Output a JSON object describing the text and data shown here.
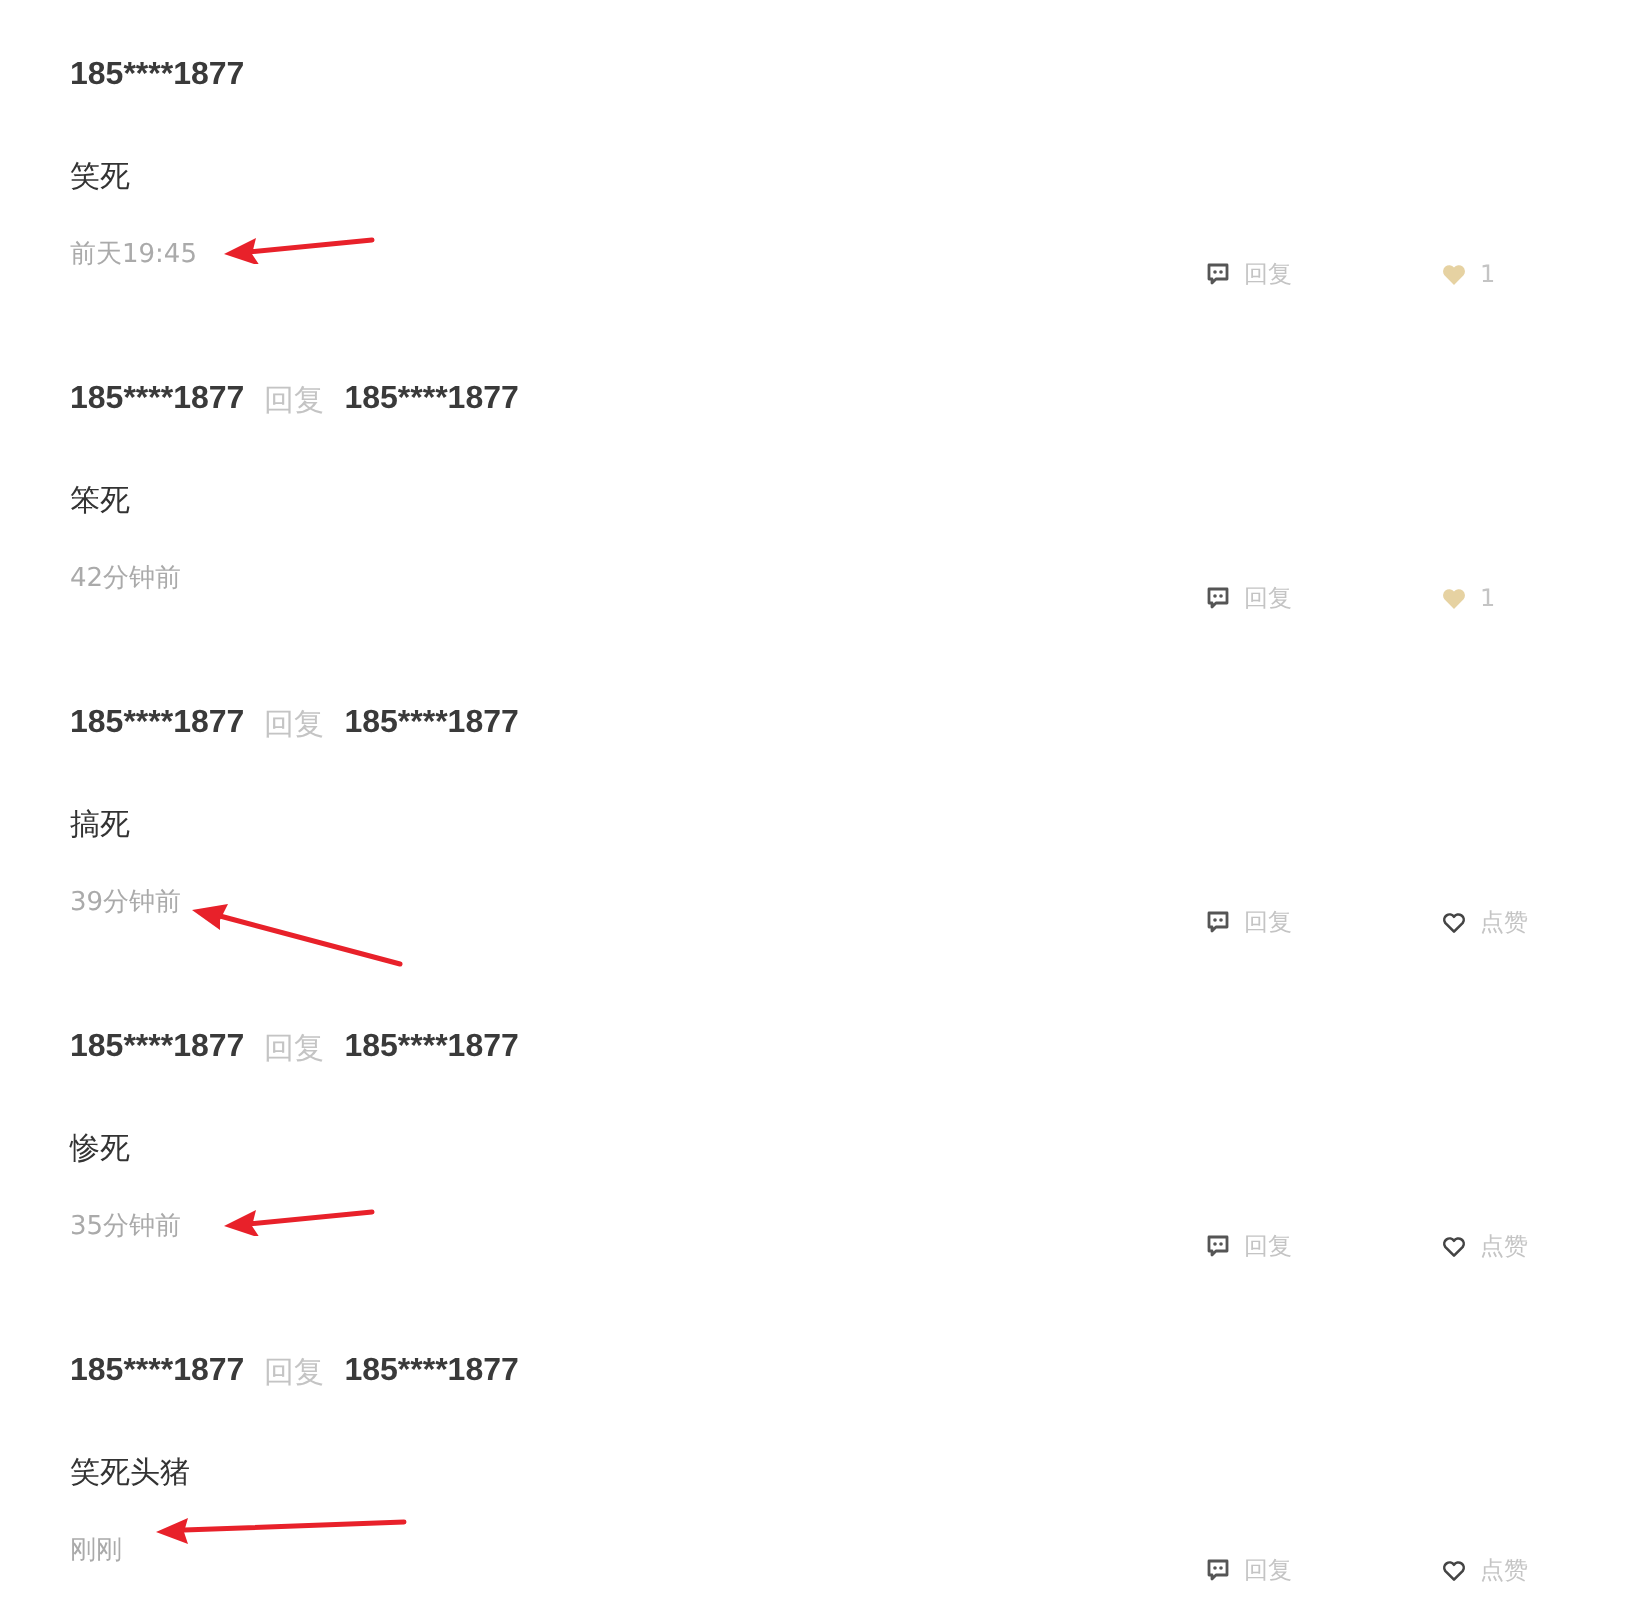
{
  "comments": [
    {
      "author": "185****1877",
      "content": "笑死",
      "time": "前天19:45",
      "reply_action": "回复",
      "liked": true,
      "like_text": "1",
      "annotated": true
    },
    {
      "author": "185****1877",
      "reply_word": "回复",
      "reply_to": "185****1877",
      "content": "笨死",
      "time": "42分钟前",
      "reply_action": "回复",
      "liked": true,
      "like_text": "1",
      "annotated": false
    },
    {
      "author": "185****1877",
      "reply_word": "回复",
      "reply_to": "185****1877",
      "content": "搞死",
      "time": "39分钟前",
      "reply_action": "回复",
      "liked": false,
      "like_text": "点赞",
      "annotated": true
    },
    {
      "author": "185****1877",
      "reply_word": "回复",
      "reply_to": "185****1877",
      "content": "惨死",
      "time": "35分钟前",
      "reply_action": "回复",
      "liked": false,
      "like_text": "点赞",
      "annotated": true
    },
    {
      "author": "185****1877",
      "reply_word": "回复",
      "reply_to": "185****1877",
      "content": "笑死头猪",
      "time": "刚刚",
      "reply_action": "回复",
      "liked": false,
      "like_text": "点赞",
      "annotated": true
    }
  ]
}
